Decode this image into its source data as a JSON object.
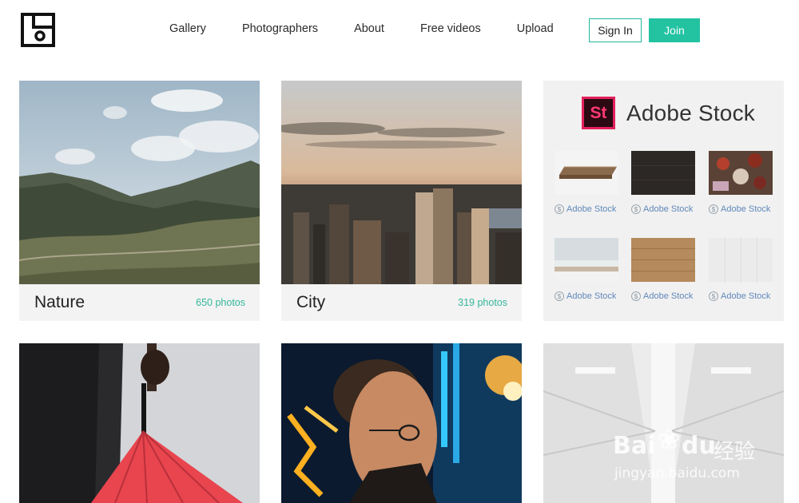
{
  "nav": {
    "items": [
      "Gallery",
      "Photographers",
      "About",
      "Free videos",
      "Upload"
    ],
    "sign_in": "Sign In",
    "join": "Join"
  },
  "logo": {
    "icon": "camera-logo-icon"
  },
  "categories": [
    {
      "title": "Nature",
      "count": "650 photos"
    },
    {
      "title": "City",
      "count": "319 photos"
    }
  ],
  "stock": {
    "badge": "St",
    "name": "Adobe Stock",
    "link_label": "Adobe Stock",
    "coin_symbol": "$"
  },
  "watermark": {
    "brand": "Bai",
    "brand2": "du",
    "cn": "经验",
    "url": "jingyan.baidu.com"
  },
  "colors": {
    "accent": "#23c3a2",
    "count_text": "#34b79b",
    "stock_link": "#6088ba",
    "st_badge": "#e4205d"
  }
}
